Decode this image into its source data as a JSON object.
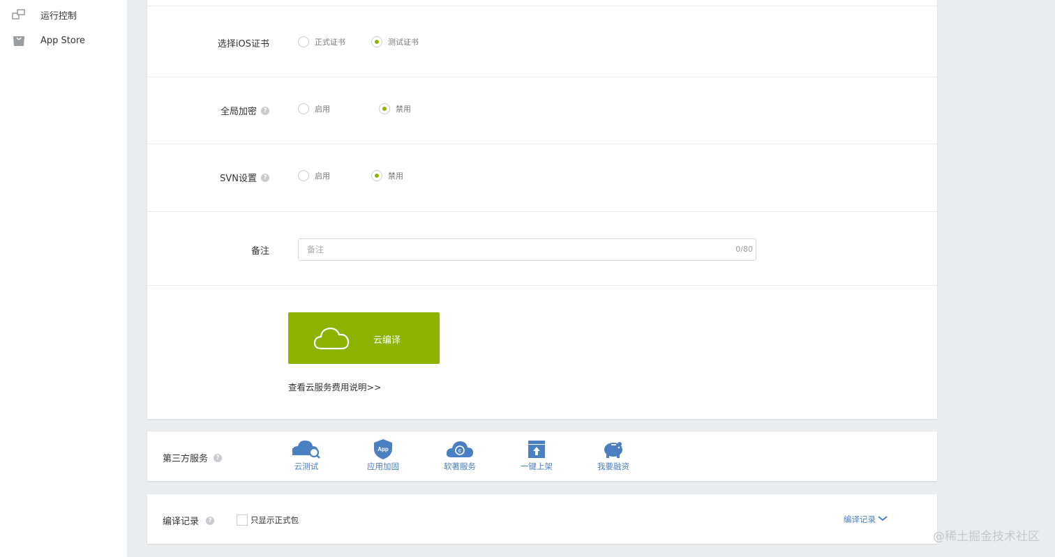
{
  "sidebar": {
    "items": [
      {
        "label": "运行控制",
        "icon": "window-icon"
      },
      {
        "label": "App Store",
        "icon": "bag-icon"
      }
    ]
  },
  "form": {
    "cert": {
      "label": "选择iOS证书",
      "options": [
        "正式证书",
        "测试证书"
      ],
      "selected": "测试证书"
    },
    "encrypt": {
      "label": "全局加密",
      "options": [
        "启用",
        "禁用"
      ],
      "selected": "禁用"
    },
    "svn": {
      "label": "SVN设置",
      "options": [
        "启用",
        "禁用"
      ],
      "selected": "禁用"
    },
    "note": {
      "label": "备注",
      "placeholder": "备注",
      "value": "",
      "counter": "0/80"
    },
    "build_button": "云编译",
    "fee_link": "查看云服务费用说明>>"
  },
  "third_party": {
    "label": "第三方服务",
    "services": [
      {
        "label": "云测试",
        "icon": "cloud-search-icon"
      },
      {
        "label": "应用加固",
        "icon": "app-shield-icon"
      },
      {
        "label": "软著服务",
        "icon": "cloud-copyright-icon"
      },
      {
        "label": "一键上架",
        "icon": "upload-box-icon"
      },
      {
        "label": "我要融资",
        "icon": "piggy-bank-icon"
      }
    ]
  },
  "build_record": {
    "label": "编译记录",
    "checkbox_label": "只显示正式包",
    "link": "编译记录"
  },
  "watermark": "@稀土掘金技术社区",
  "colors": {
    "accent": "#8cb300",
    "link": "#4a7fc1",
    "icon_blue": "#4a7fc1"
  }
}
